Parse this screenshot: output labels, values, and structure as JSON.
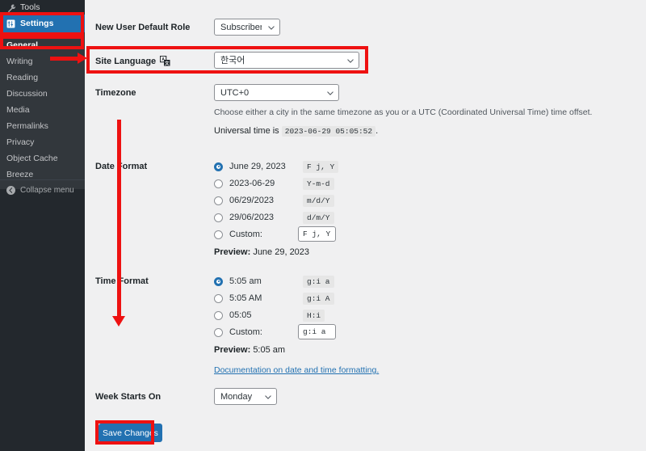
{
  "sidebar": {
    "top_item": {
      "label": "Tools",
      "icon": "wrench-icon"
    },
    "active_item": {
      "label": "Settings",
      "icon": "settings-sliders-icon"
    },
    "submenu": [
      {
        "label": "General",
        "current": true
      },
      {
        "label": "Writing",
        "current": false
      },
      {
        "label": "Reading",
        "current": false
      },
      {
        "label": "Discussion",
        "current": false
      },
      {
        "label": "Media",
        "current": false
      },
      {
        "label": "Permalinks",
        "current": false
      },
      {
        "label": "Privacy",
        "current": false
      },
      {
        "label": "Object Cache",
        "current": false
      },
      {
        "label": "Breeze",
        "current": false
      }
    ],
    "collapse": {
      "label": "Collapse menu",
      "icon": "collapse-arrow-icon"
    }
  },
  "settings": {
    "new_user_default_role": {
      "label": "New User Default Role",
      "value": "Subscriber"
    },
    "site_language": {
      "label": "Site Language",
      "icon": "translate-icon",
      "value": "한국어"
    },
    "timezone": {
      "label": "Timezone",
      "value": "UTC+0",
      "help": "Choose either a city in the same timezone as you or a UTC (Coordinated Universal Time) time offset.",
      "universal_time_prefix": "Universal time is",
      "universal_time_value": "2023-06-29 05:05:52",
      "universal_time_suffix": "."
    },
    "date_format": {
      "label": "Date Format",
      "options": [
        {
          "display": "June 29, 2023",
          "code": "F j, Y",
          "selected": true,
          "custom": false
        },
        {
          "display": "2023-06-29",
          "code": "Y-m-d",
          "selected": false,
          "custom": false
        },
        {
          "display": "06/29/2023",
          "code": "m/d/Y",
          "selected": false,
          "custom": false
        },
        {
          "display": "29/06/2023",
          "code": "d/m/Y",
          "selected": false,
          "custom": false
        },
        {
          "display": "Custom:",
          "code": "F j, Y",
          "selected": false,
          "custom": true
        }
      ],
      "preview_label": "Preview:",
      "preview_value": "June 29, 2023"
    },
    "time_format": {
      "label": "Time Format",
      "options": [
        {
          "display": "5:05 am",
          "code": "g:i a",
          "selected": true,
          "custom": false
        },
        {
          "display": "5:05 AM",
          "code": "g:i A",
          "selected": false,
          "custom": false
        },
        {
          "display": "05:05",
          "code": "H:i",
          "selected": false,
          "custom": false
        },
        {
          "display": "Custom:",
          "code": "g:i a",
          "selected": false,
          "custom": true
        }
      ],
      "preview_label": "Preview:",
      "preview_value": "5:05 am"
    },
    "documentation_link": "Documentation on date and time formatting",
    "documentation_link_period": ".",
    "week_starts_on": {
      "label": "Week Starts On",
      "value": "Monday"
    },
    "save_button": "Save Changes"
  },
  "colors": {
    "annotation_red": "#ee1111",
    "wp_blue": "#2271b1",
    "sidebar_dark": "#23282d",
    "submenu_dark": "#32373c",
    "content_bg": "#f0f0f1"
  }
}
